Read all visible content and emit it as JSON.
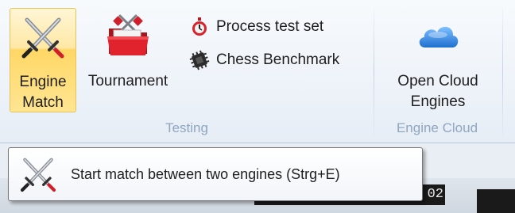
{
  "ribbon": {
    "groups": {
      "testing": {
        "label": "Testing",
        "engine_match": {
          "line1": "Engine",
          "line2": "Match",
          "icon": "crossed-swords-icon"
        },
        "tournament": {
          "label": "Tournament",
          "icon": "tournament-folder-icon"
        },
        "process_test_set": {
          "label": "Process test set",
          "icon": "stopwatch-icon"
        },
        "chess_benchmark": {
          "label": "Chess Benchmark",
          "icon": "chip-icon"
        }
      },
      "engine_cloud": {
        "label": "Engine Cloud",
        "open_cloud": {
          "line1": "Open Cloud",
          "line2": "Engines",
          "icon": "cloud-icon"
        }
      }
    }
  },
  "tooltip": {
    "text": "Start match between two engines (Strg+E)",
    "icon": "crossed-swords-icon"
  },
  "background": {
    "clock_fragment": "02"
  },
  "colors": {
    "active_highlight": "#ffd766",
    "group_label": "#8fa6bf",
    "cloud_blue": "#2a7fd8"
  }
}
